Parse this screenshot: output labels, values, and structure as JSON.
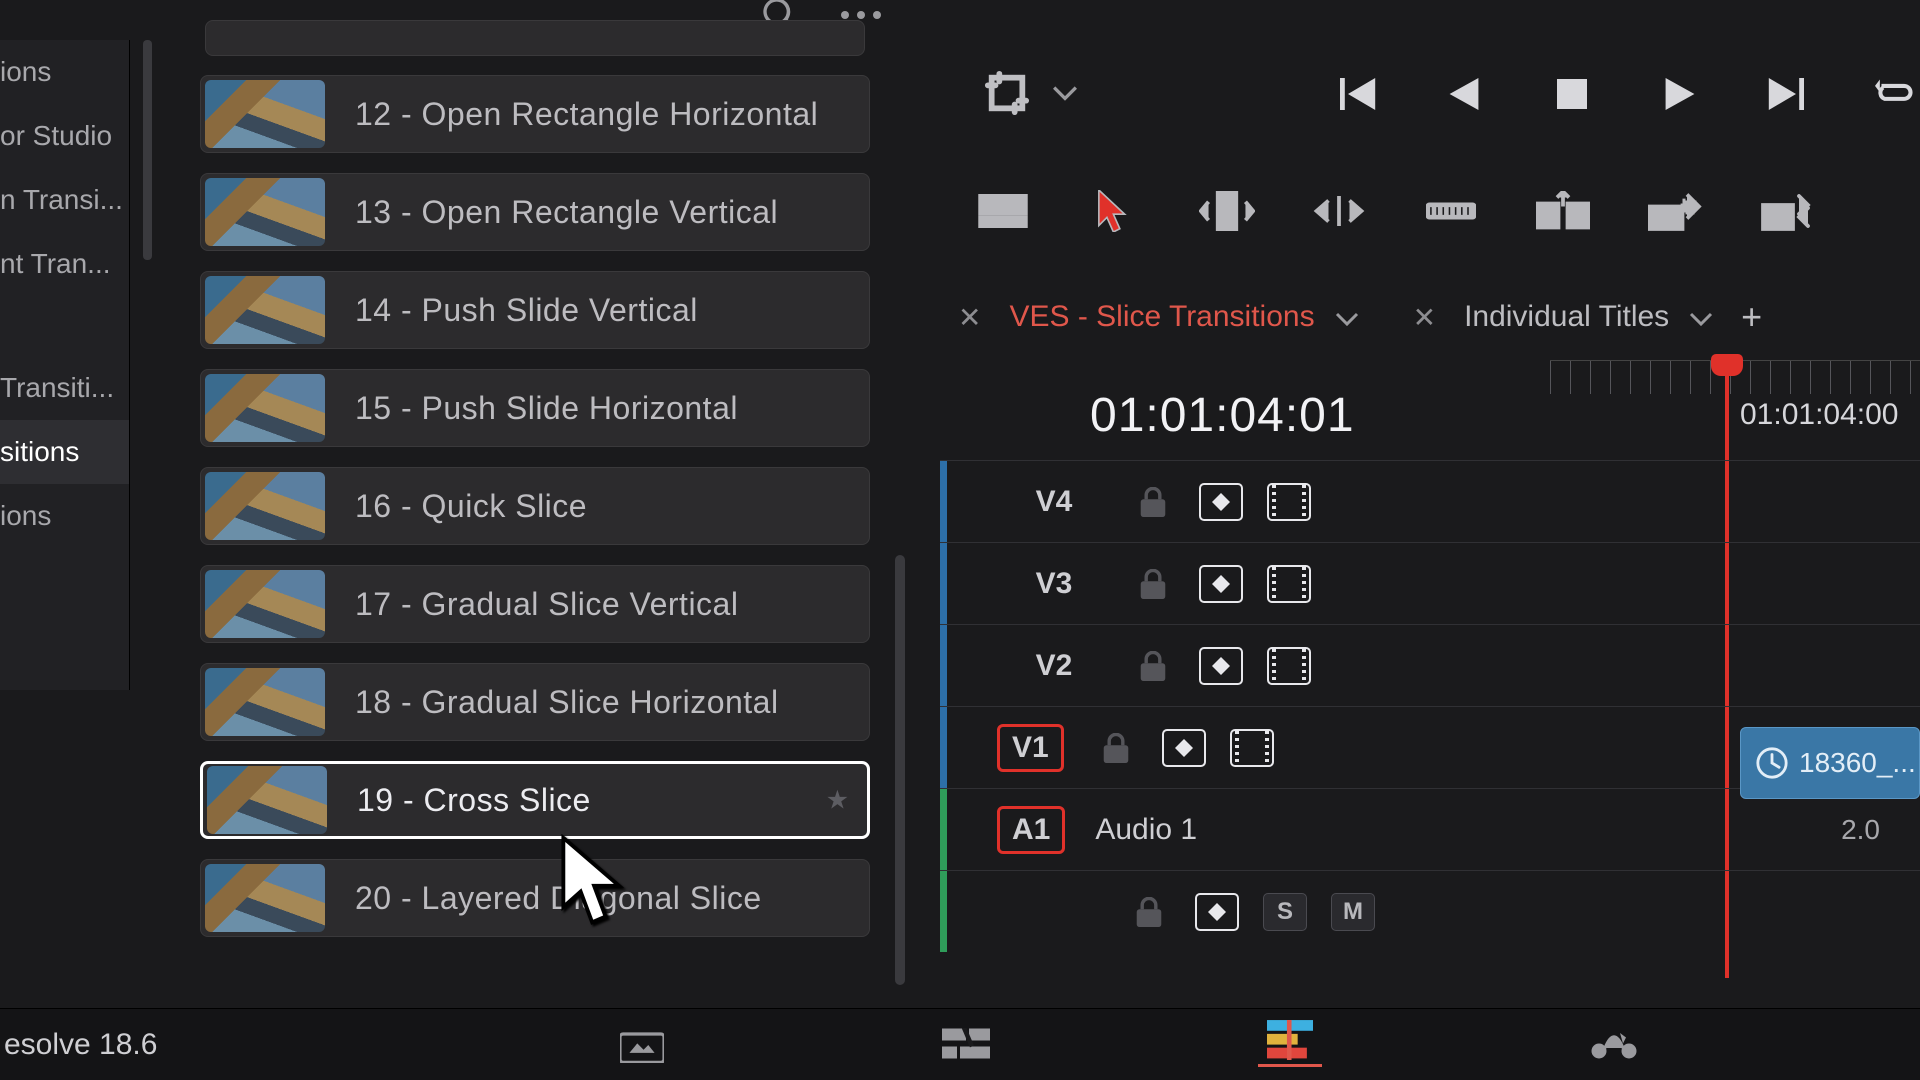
{
  "sidebar": {
    "categories": [
      {
        "label": "ions"
      },
      {
        "label": "or Studio"
      },
      {
        "label": "n Transi..."
      },
      {
        "label": "nt Tran..."
      },
      {
        "label": "Transiti..."
      },
      {
        "label": "sitions"
      },
      {
        "label": "ions"
      }
    ],
    "selected_index": 5
  },
  "effects": {
    "items": [
      {
        "label": "12 - Open Rectangle Horizontal"
      },
      {
        "label": "13 - Open Rectangle Vertical"
      },
      {
        "label": "14 - Push Slide Vertical"
      },
      {
        "label": "15 - Push Slide Horizontal"
      },
      {
        "label": "16 - Quick Slice"
      },
      {
        "label": "17 - Gradual Slice Vertical"
      },
      {
        "label": "18 - Gradual Slice Horizontal"
      },
      {
        "label": "19 - Cross Slice"
      },
      {
        "label": "20 - Layered Diagonal Slice"
      }
    ],
    "selected_index": 7
  },
  "tabs": {
    "items": [
      {
        "name": "VES - Slice Transitions",
        "active": true
      },
      {
        "name": "Individual Titles",
        "active": false
      }
    ]
  },
  "timecode": {
    "main": "01:01:04:01",
    "ruler": "01:01:04:00"
  },
  "tracks": {
    "video": [
      {
        "name": "V4"
      },
      {
        "name": "V3"
      },
      {
        "name": "V2"
      },
      {
        "name": "V1",
        "boxed": true
      }
    ],
    "audio": {
      "name": "A1",
      "label": "Audio 1",
      "channels": "2.0",
      "s": "S",
      "m": "M"
    }
  },
  "clip": {
    "label": "18360_..."
  },
  "footer": {
    "version": "esolve 18.6"
  }
}
